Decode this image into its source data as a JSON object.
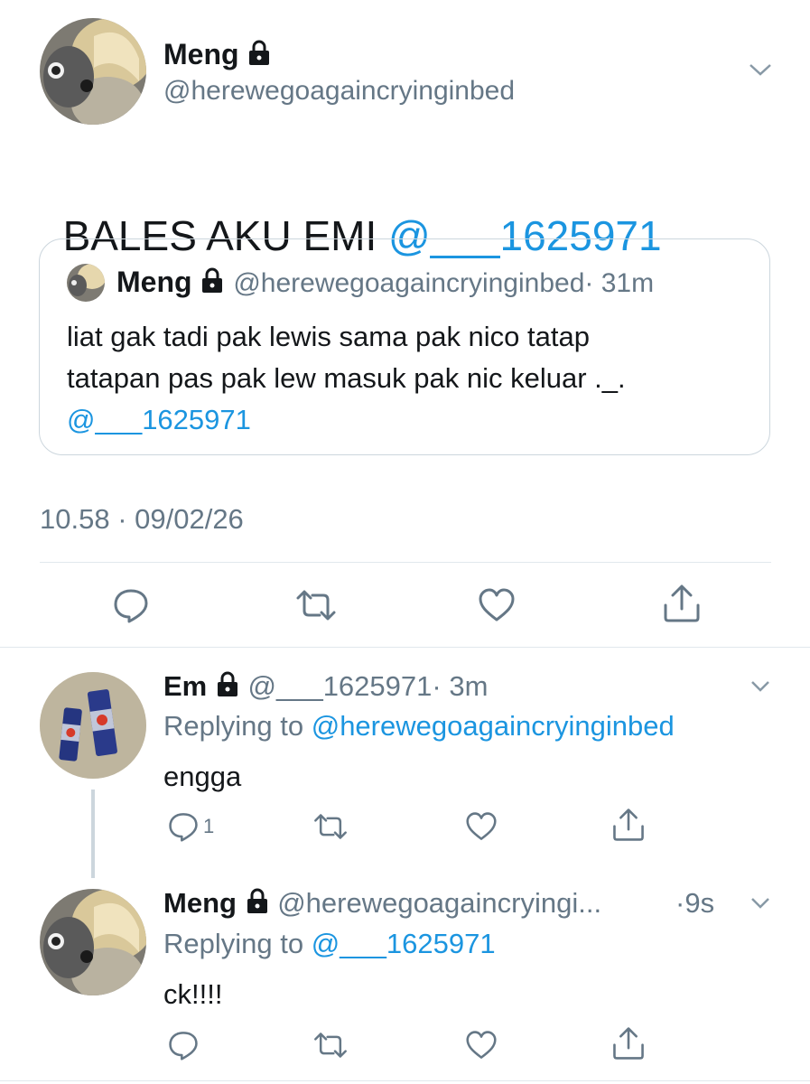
{
  "main_tweet": {
    "name": "Meng",
    "handle": "@herewegoagaincryinginbed",
    "text": "BALES AKU EMI ",
    "mention": "@___1625971",
    "timestamp": "10.58 · 09/02/26",
    "quoted": {
      "name": "Meng",
      "handle": "@herewegoagaincryinginbed",
      "time": "· 31m",
      "line1": "liat gak tadi pak lewis sama pak nico tatap",
      "line2": "tatapan pas pak lew masuk pak nic keluar ._.",
      "mention": "@___1625971"
    }
  },
  "replies": [
    {
      "name": "Em",
      "handle": "@___1625971",
      "time": "· 3m",
      "replying_prefix": "Replying to ",
      "replying_to": "@herewegoagaincryinginbed",
      "text": "engga",
      "reply_count": "1"
    },
    {
      "name": "Meng",
      "handle": "@herewegoagaincryingi...",
      "time": "·9s",
      "replying_prefix": "Replying to ",
      "replying_to": "@___1625971",
      "text": "ck!!!!"
    }
  ],
  "icons": [
    "lock-icon",
    "chevron-down-icon",
    "reply-icon",
    "retweet-icon",
    "like-icon",
    "share-icon"
  ],
  "colors": {
    "accent": "#1b95e0",
    "muted": "#657786",
    "divider": "#e1e8ed"
  }
}
